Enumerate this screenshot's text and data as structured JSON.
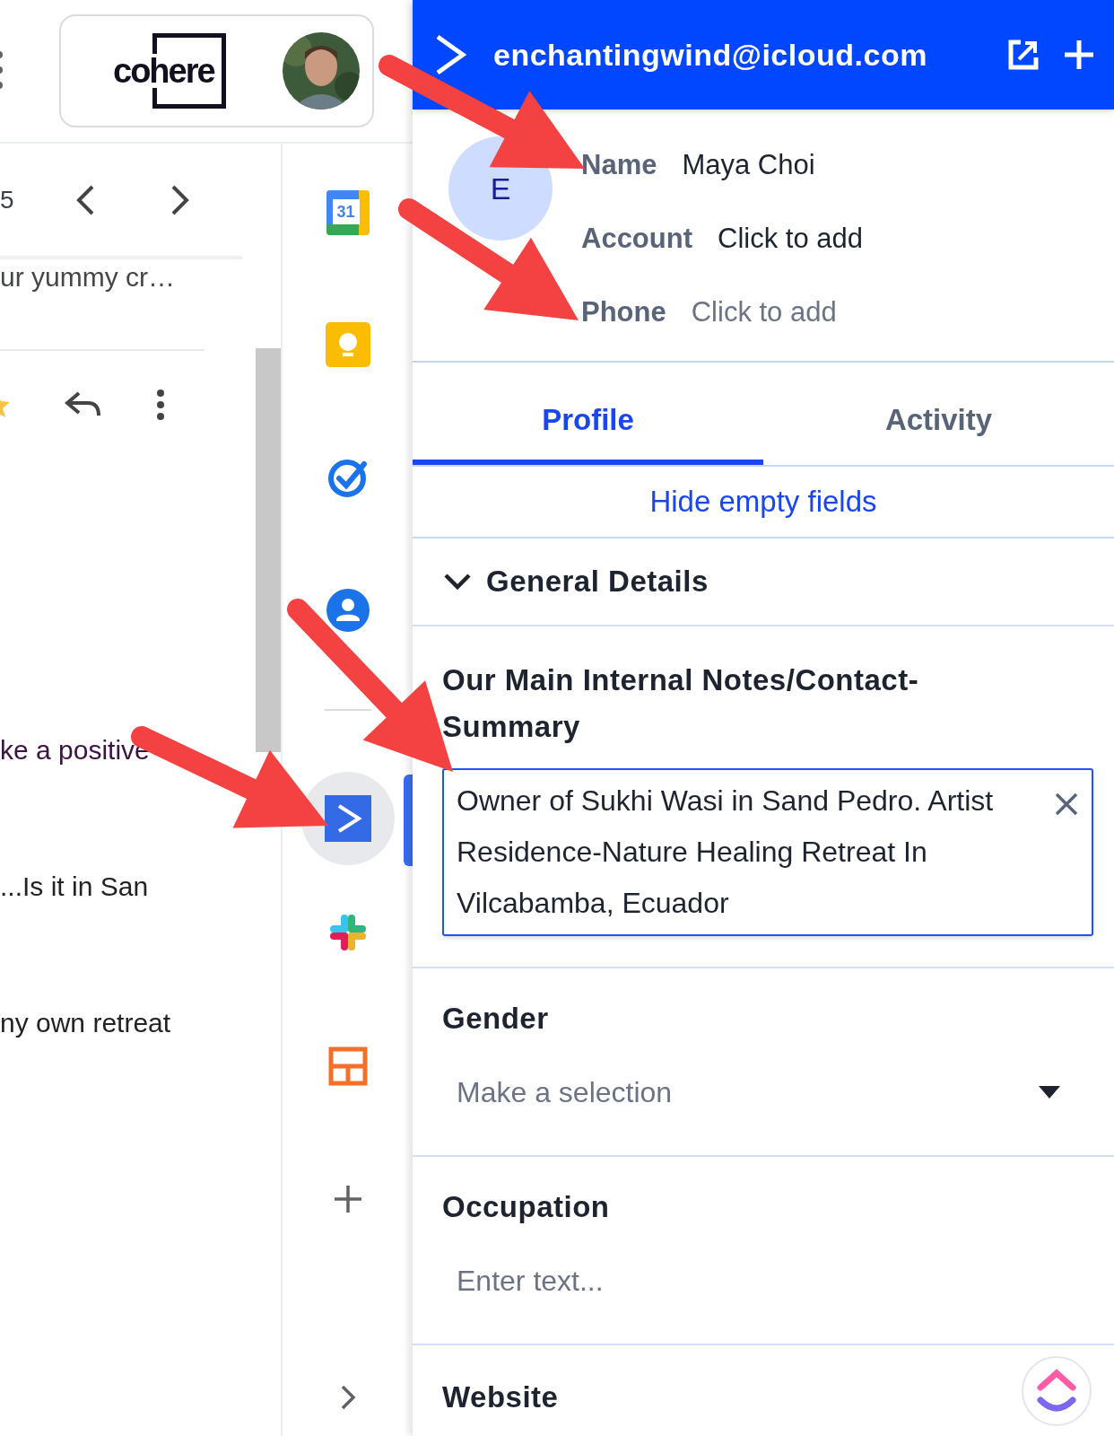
{
  "topbar": {
    "logo": "cohere"
  },
  "mail": {
    "count": "5",
    "snippet": "ur yummy cr…",
    "lines": [
      {
        "text": "ke a positive",
        "kind": "link"
      },
      {
        "text": "...Is it in San",
        "kind": "text"
      },
      {
        "text": "ny own retreat",
        "kind": "text"
      }
    ]
  },
  "sidebar": {
    "google_apps": [
      {
        "kind": "calendar",
        "label": "31",
        "selected": false
      },
      {
        "kind": "keep",
        "selected": false
      },
      {
        "kind": "tasks",
        "selected": false
      },
      {
        "kind": "contacts",
        "selected": false
      }
    ],
    "addons": [
      {
        "kind": "crm",
        "selected": true
      },
      {
        "kind": "slack",
        "selected": false
      },
      {
        "kind": "layout",
        "selected": false
      },
      {
        "kind": "add",
        "selected": false
      }
    ]
  },
  "panel": {
    "title": "enchantingwind@icloud.com",
    "avatar_initial": "E",
    "contact_fields": [
      {
        "label": "Name",
        "value": "Maya Choi",
        "muted": false
      },
      {
        "label": "Account",
        "value": "Click to add",
        "muted": false
      },
      {
        "label": "Phone",
        "value": "Click to add",
        "muted": true
      }
    ],
    "tabs": [
      {
        "label": "Profile",
        "selected": true
      },
      {
        "label": "Activity",
        "selected": false
      }
    ],
    "hide_empty_link": "Hide empty fields",
    "section": {
      "title": "General Details",
      "expanded": true
    },
    "fields": [
      {
        "kind": "textarea",
        "label": "Our Main Internal Notes/Contact-Summary",
        "value": "Owner of Sukhi Wasi in Sand Pedro. Artist Residence-Nature Healing Retreat In Vilcabamba, Ecuador"
      },
      {
        "kind": "select",
        "label": "Gender",
        "placeholder": "Make a selection"
      },
      {
        "kind": "text",
        "label": "Occupation",
        "placeholder": "Enter text..."
      },
      {
        "kind": "heading",
        "label": "Website"
      }
    ]
  }
}
